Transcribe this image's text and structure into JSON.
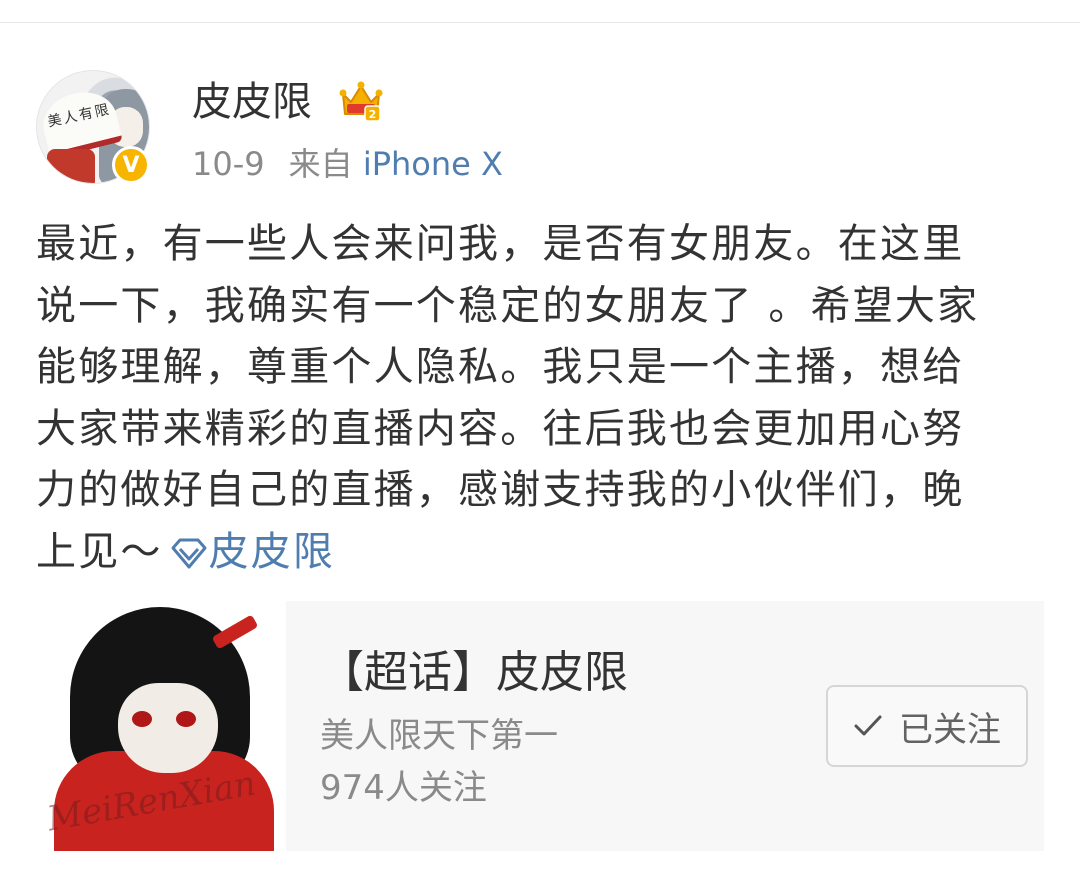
{
  "post": {
    "author": {
      "name": "皮皮限",
      "avatar_caption": "美人有限"
    },
    "date": "10-9",
    "source_prefix": "来自",
    "source_device": "iPhone X",
    "content_lines": [
      "最近，有一些人会来问我，是否有女朋友。在这里",
      "说一下，我确实有一个稳定的女朋友了 。希望大家",
      "能够理解，尊重个人隐私。我只是一个主播，想给",
      "大家带来精彩的直播内容。往后我也会更加用心努",
      "力的做好自己的直播，感谢支持我的小伙伴们，晚"
    ],
    "content_last_line_prefix": "上见～",
    "supertopic_mention": "皮皮限"
  },
  "card": {
    "title": "【超话】皮皮限",
    "subtitle": "美人限天下第一",
    "followers": "974人关注",
    "follow_button_label": "已关注",
    "image_signature": "MeiRenXian"
  },
  "colors": {
    "link": "#507daf",
    "verified": "#f7b500",
    "vip_crown": "#f5b000"
  },
  "icons": {
    "verified": "verified-badge-icon",
    "vip": "vip-crown-icon",
    "supertopic": "supertopic-diamond-icon",
    "check": "check-icon"
  }
}
